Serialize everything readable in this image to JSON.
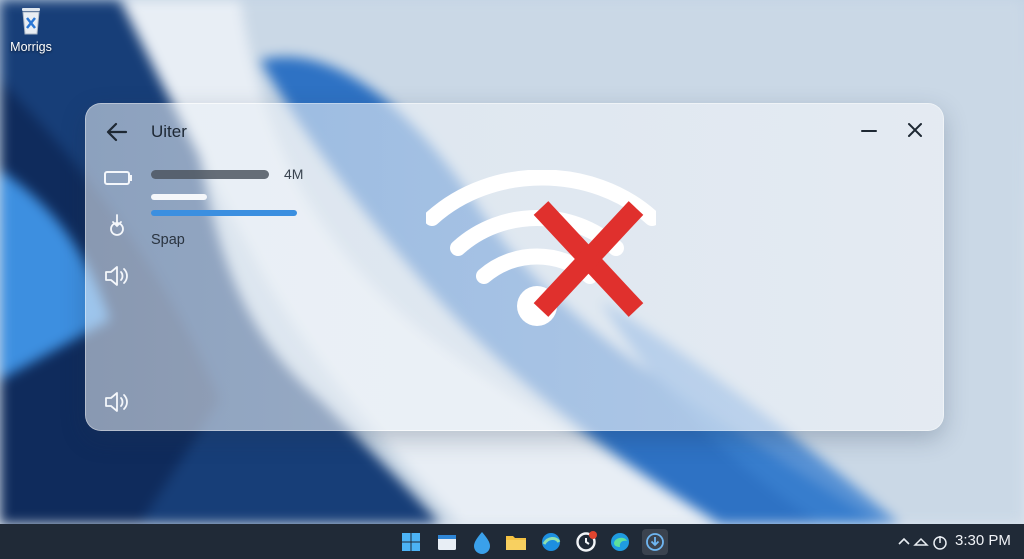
{
  "desktop": {
    "icons": [
      {
        "label": "Morrigs",
        "icon": "recycle-bin-icon"
      }
    ]
  },
  "panel": {
    "title": "Uiter",
    "size_label": "4M",
    "item_label": "Spap",
    "progress_fraction": 0.88,
    "status_graphic": "wifi-disconnected-icon",
    "colors": {
      "progress": "#3b8fe0",
      "error_x": "#e0302d"
    }
  },
  "taskbar": {
    "apps": [
      "start-icon",
      "file-explorer-icon",
      "app-icon",
      "folder-icon",
      "browser-icon",
      "clock-app-icon",
      "edge-icon",
      "download-icon"
    ],
    "badge_count": "",
    "tray": [
      "chevron-up-icon",
      "network-icon",
      "timer-icon"
    ],
    "clock": "3:30 PM"
  }
}
